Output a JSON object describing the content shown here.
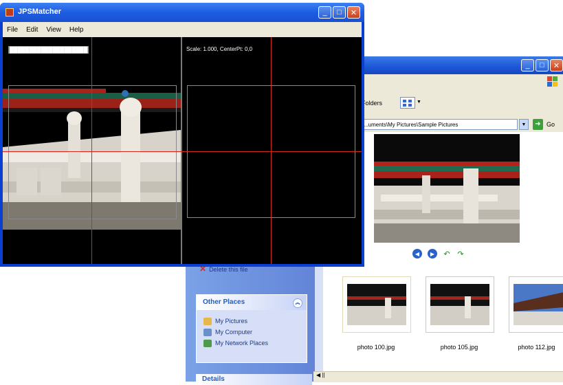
{
  "jps": {
    "title": "JPSMatcher",
    "menu": [
      "File",
      "Edit",
      "View",
      "Help"
    ],
    "left_label": "████████████████████",
    "right_label": "Scale: 1.000, CenterPt: 0,0"
  },
  "explorer": {
    "folders_label": "Folders",
    "address": "...uments\\My Pictures\\Sample Pictures",
    "go_label": "Go",
    "delete_label": "Delete this file",
    "other_places": {
      "title": "Other Places",
      "items": [
        "My Pictures",
        "My Computer",
        "My Network Places"
      ]
    },
    "details_title": "Details",
    "thumbnails": [
      "photo 100.jpg",
      "photo 105.jpg",
      "photo 112.jpg"
    ],
    "status": "◀ ||"
  },
  "colors": {
    "xp_title": "#1d5de4",
    "crosshair": "#d4281e",
    "task_pane": "#6384d8"
  }
}
